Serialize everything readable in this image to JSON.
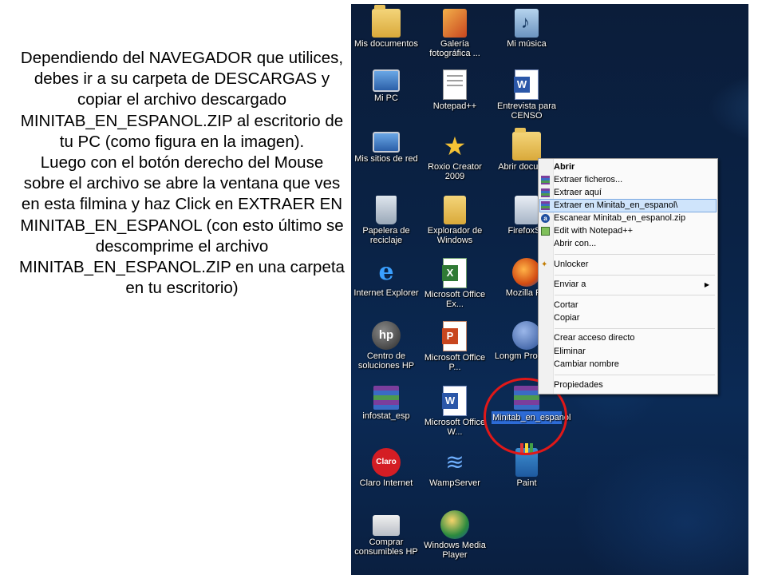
{
  "instructions": {
    "paragraph1": "Dependiendo del NAVEGADOR que utilices, debes ir a su carpeta de DESCARGAS y copiar el archivo descargado MINITAB_EN_ESPANOL.ZIP al escritorio de tu PC (como figura en la imagen).",
    "paragraph2": "Luego con el botón derecho del Mouse sobre el archivo se abre la ventana que ves en esta filmina y haz Click en EXTRAER EN MINITAB_EN_ESPANOL (con esto último se descomprime el archivo MINITAB_EN_ESPANOL.ZIP en una carpeta en tu escritorio)"
  },
  "desktop": {
    "icons": [
      {
        "key": "mis-documentos",
        "label": "Mis documentos",
        "icon": "folder-icon"
      },
      {
        "key": "galeria",
        "label": "Galería fotográfica ...",
        "icon": "photo-gallery-icon"
      },
      {
        "key": "mi-musica",
        "label": "Mi música",
        "icon": "music-folder-icon"
      },
      {
        "key": "mi-pc",
        "label": "Mi PC",
        "icon": "computer-icon"
      },
      {
        "key": "notepadpp",
        "label": "Notepad++",
        "icon": "notepad-icon"
      },
      {
        "key": "entrevista",
        "label": "Entrevista para CENSO",
        "icon": "word-document-icon"
      },
      {
        "key": "mis-sitios",
        "label": "Mis sitios de red",
        "icon": "network-icon"
      },
      {
        "key": "roxio",
        "label": "Roxio Creator 2009",
        "icon": "star-icon"
      },
      {
        "key": "abrir-doc",
        "label": "Abrir documen",
        "icon": "folder-icon"
      },
      {
        "key": "papelera",
        "label": "Papelera de reciclaje",
        "icon": "recycle-bin-icon"
      },
      {
        "key": "explorador",
        "label": "Explorador de Windows",
        "icon": "explorer-icon"
      },
      {
        "key": "firefoxset",
        "label": "FirefoxSe",
        "icon": "setup-icon"
      },
      {
        "key": "ie",
        "label": "Internet Explorer",
        "icon": "internet-explorer-icon"
      },
      {
        "key": "excel",
        "label": "Microsoft Office Ex...",
        "icon": "excel-icon"
      },
      {
        "key": "firefox",
        "label": "Mozilla Firi",
        "icon": "firefox-icon"
      },
      {
        "key": "hp",
        "label": "Centro de soluciones HP",
        "icon": "hp-icon"
      },
      {
        "key": "ppt",
        "label": "Microsoft Office P...",
        "icon": "powerpoint-icon"
      },
      {
        "key": "longman",
        "label": "Longm Pronunci",
        "icon": "longman-icon"
      },
      {
        "key": "infostat",
        "label": "infostat_esp",
        "icon": "winrar-archive-icon"
      },
      {
        "key": "word",
        "label": "Microsoft Office W...",
        "icon": "word-icon"
      },
      {
        "key": "minitab",
        "label": "Minitab_en_espanol",
        "icon": "winrar-archive-icon"
      },
      {
        "key": "claro",
        "label": "Claro Internet",
        "icon": "claro-icon"
      },
      {
        "key": "wamp",
        "label": "WampServer",
        "icon": "wampserver-icon"
      },
      {
        "key": "paint",
        "label": "Paint",
        "icon": "paint-icon"
      },
      {
        "key": "comprar-hp",
        "label": "Comprar consumibles HP",
        "icon": "printer-icon"
      },
      {
        "key": "wmp",
        "label": "Windows Media Player",
        "icon": "media-player-icon"
      }
    ]
  },
  "context_menu": {
    "items": [
      {
        "label": "Abrir",
        "icon": "",
        "bold": true
      },
      {
        "label": "Extraer ficheros...",
        "icon": "winrar-icon"
      },
      {
        "label": "Extraer aquí",
        "icon": "winrar-icon"
      },
      {
        "label": "Extraer en Minitab_en_espanol\\",
        "icon": "winrar-icon",
        "highlighted": true
      },
      {
        "label": "Escanear Minitab_en_espanol.zip",
        "icon": "avast-icon"
      },
      {
        "label": "Edit with Notepad++",
        "icon": "notepadpp-icon"
      },
      {
        "label": "Abrir con...",
        "icon": ""
      },
      {
        "label": "Unlocker",
        "icon": "unlocker-icon"
      },
      {
        "label": "Enviar a",
        "icon": "",
        "submenu": true
      },
      {
        "label": "Cortar",
        "icon": ""
      },
      {
        "label": "Copiar",
        "icon": ""
      },
      {
        "label": "Crear acceso directo",
        "icon": ""
      },
      {
        "label": "Eliminar",
        "icon": ""
      },
      {
        "label": "Cambiar nombre",
        "icon": ""
      },
      {
        "label": "Propiedades",
        "icon": ""
      }
    ],
    "submenu_arrow": "▶"
  },
  "colors": {
    "highlight": "#cfe4fb",
    "selection": "#2d6bd6",
    "annotation_circle": "#e01818",
    "desktop_background": "#0b2a55"
  }
}
